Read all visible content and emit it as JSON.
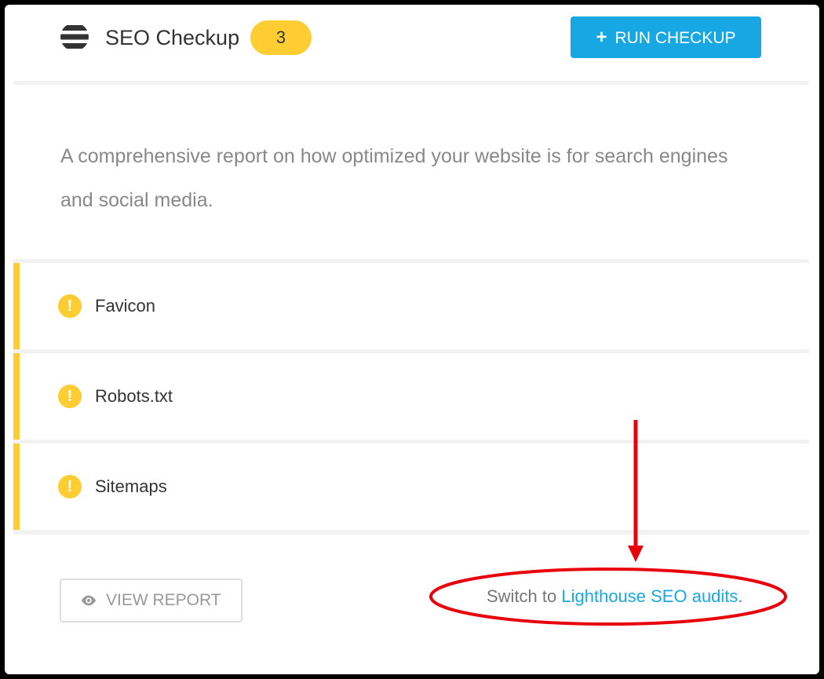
{
  "header": {
    "title": "SEO Checkup",
    "count_badge": "3",
    "run_button_label": "RUN CHECKUP",
    "run_button_icon": "plus-icon"
  },
  "description": "A comprehensive report on how optimized your website is for search engines and social media.",
  "checks": [
    {
      "label": "Favicon",
      "status": "warning",
      "icon": "warning-icon"
    },
    {
      "label": "Robots.txt",
      "status": "warning",
      "icon": "warning-icon"
    },
    {
      "label": "Sitemaps",
      "status": "warning",
      "icon": "warning-icon"
    }
  ],
  "footer": {
    "view_report_label": "VIEW REPORT",
    "view_report_icon": "eye-icon",
    "switch_prefix": "Switch to ",
    "switch_link": "Lighthouse SEO audits",
    "switch_suffix": "."
  },
  "colors": {
    "accent": "#17a8e3",
    "warning": "#fecd32",
    "annotation": "#e8000b"
  }
}
